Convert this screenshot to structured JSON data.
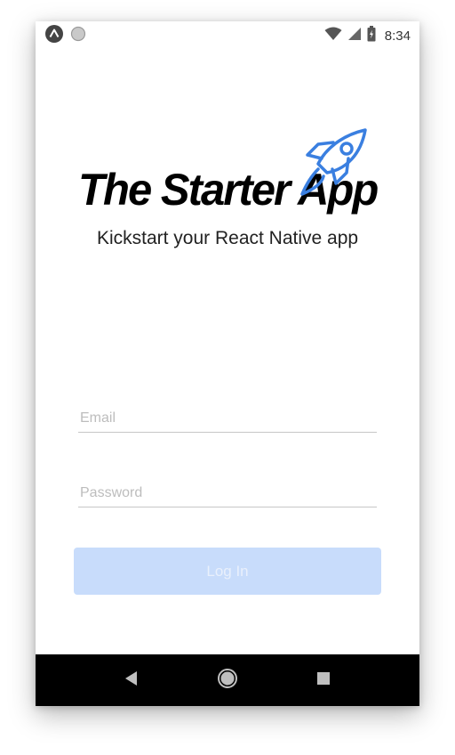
{
  "status_bar": {
    "time": "8:34",
    "left_icons": [
      "app-notification-icon",
      "circle-notification-icon"
    ],
    "right_icons": [
      "wifi-icon",
      "signal-icon",
      "battery-icon"
    ]
  },
  "hero": {
    "title": "The Starter App",
    "subtitle": "Kickstart your React Native app",
    "logo_icon": "rocket-icon"
  },
  "login_form": {
    "email_placeholder": "Email",
    "email_value": "",
    "password_placeholder": "Password",
    "password_value": "",
    "login_label": "Log In"
  },
  "nav_bar": {
    "buttons": [
      "back-icon",
      "home-icon",
      "recents-icon"
    ]
  },
  "colors": {
    "accent": "#3a7fe0",
    "button_bg": "#c8dcfb",
    "button_text": "#e9f0fc",
    "nav_bg": "#000000"
  }
}
